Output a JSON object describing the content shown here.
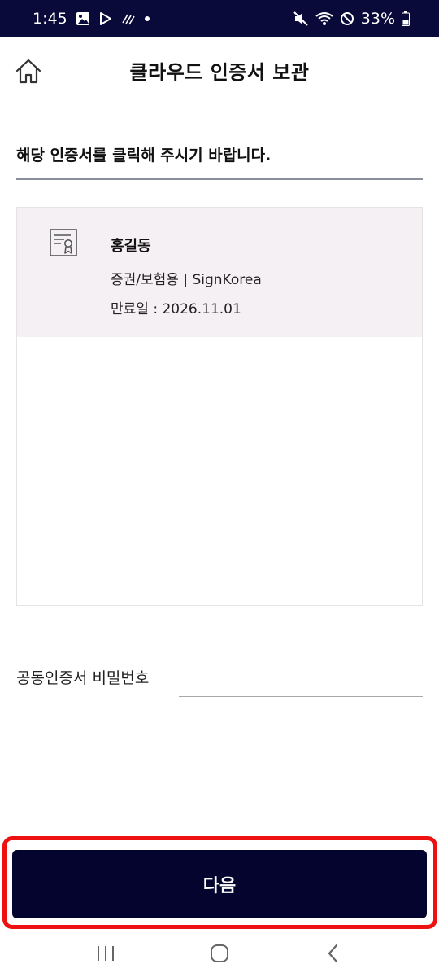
{
  "status_bar": {
    "time": "1:45",
    "battery": "33%",
    "icons": [
      "image-icon",
      "play-store-icon",
      "signal-lines-icon",
      "dot-icon",
      "mute-icon",
      "wifi-icon",
      "do-not-disturb-icon",
      "battery-icon"
    ]
  },
  "header": {
    "title": "클라우드 인증서 보관",
    "home_icon": "home-icon"
  },
  "instruction": "해당 인증서를 클릭해 주시기 바랍니다.",
  "certificates": [
    {
      "name": "홍길동",
      "type": "증권/보험용 | SignKorea",
      "expiry": "만료일 : 2026.11.01",
      "icon": "certificate-icon"
    }
  ],
  "password": {
    "label": "공동인증서 비밀번호",
    "value": "",
    "placeholder": ""
  },
  "next_button": {
    "label": "다음"
  },
  "nav_bar": {
    "icons": [
      "recent-apps-icon",
      "home-nav-icon",
      "back-icon"
    ]
  },
  "colors": {
    "status_bar": "#0a0a3a",
    "button": "#04042e",
    "highlight": "#ee1111",
    "cert_item_bg": "#f5f0f3"
  }
}
